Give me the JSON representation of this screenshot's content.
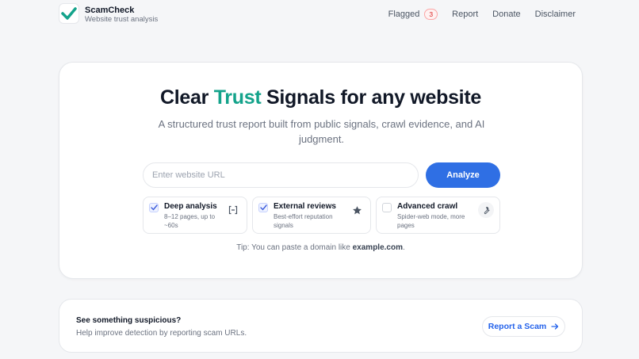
{
  "header": {
    "brand_name": "ScamCheck",
    "brand_tagline": "Website trust analysis",
    "nav": {
      "flagged_label": "Flagged",
      "flagged_count": "3",
      "report_label": "Report",
      "donate_label": "Donate",
      "disclaimer_label": "Disclaimer"
    }
  },
  "hero": {
    "title_prefix": "Clear ",
    "title_accent": "Trust",
    "title_suffix": " Signals for any website",
    "subtitle": "A structured trust report built from public signals, crawl evidence, and AI judgment.",
    "url_placeholder": "Enter website URL",
    "url_value": "",
    "analyze_label": "Analyze",
    "options": [
      {
        "title": "Deep analysis",
        "desc": "8–12 pages, up to ~60s",
        "checked": true,
        "icon": "brackets-icon"
      },
      {
        "title": "External reviews",
        "desc": "Best-effort reputation signals",
        "checked": true,
        "icon": "star-icon"
      },
      {
        "title": "Advanced crawl",
        "desc": "Spider-web mode, more pages",
        "checked": false,
        "icon": "wrench-icon"
      }
    ],
    "tip_prefix": "Tip: You can paste a domain like ",
    "tip_example": "example.com",
    "tip_suffix": "."
  },
  "report_card": {
    "title": "See something suspicious?",
    "desc": "Help improve detection by reporting scam URLs.",
    "button_label": "Report a Scam"
  },
  "colors": {
    "accent": "#14a38b",
    "primary": "#2f6fe4",
    "badge": "#dc2626"
  }
}
